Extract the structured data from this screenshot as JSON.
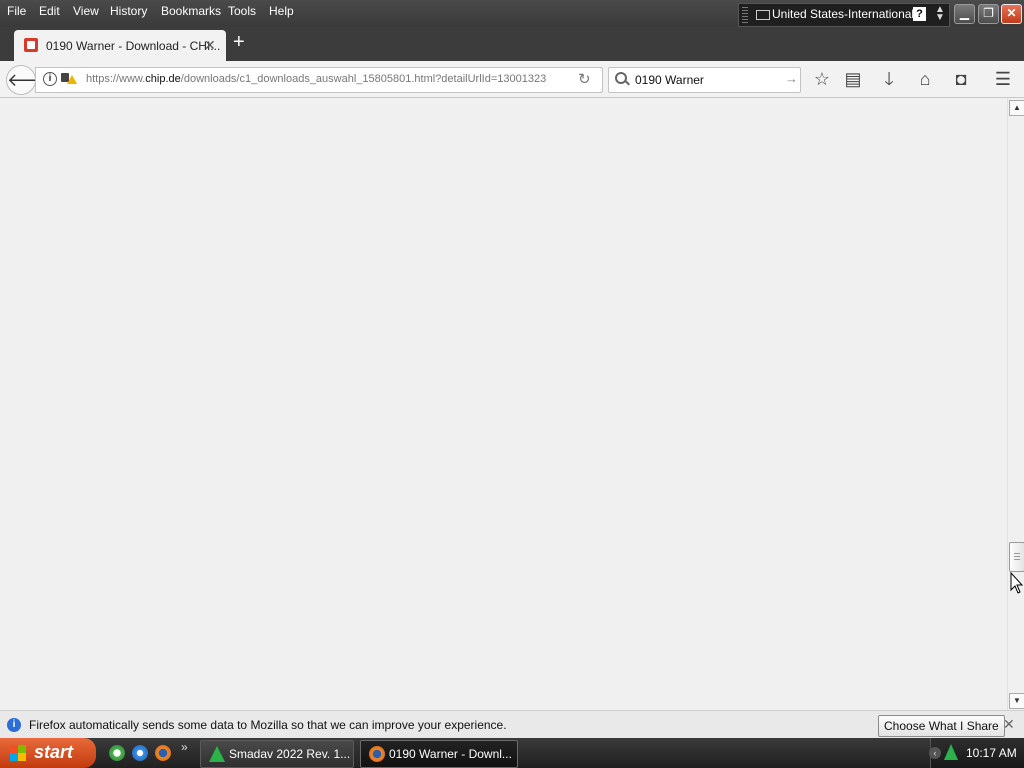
{
  "menubar": {
    "items": [
      "File",
      "Edit",
      "View",
      "History",
      "Bookmarks",
      "Tools",
      "Help"
    ]
  },
  "language_bar": {
    "language": "United States-International",
    "help": "?"
  },
  "tabs": {
    "active_title": "0190 Warner - Download - CHI...",
    "new_tab_symbol": "+"
  },
  "navbar": {
    "url_prefix": "https://www.",
    "url_host": "chip.de",
    "url_path": "/downloads/c1_downloads_auswahl_15805801.html?detailUrlId=13001323",
    "search_value": "0190 Warner"
  },
  "notification": {
    "message": "Firefox automatically sends some data to Mozilla so that we can improve your experience.",
    "share_button": "Choose What I Share"
  },
  "taskbar": {
    "start_label": "start",
    "tasks": [
      {
        "label": "Smadav 2022 Rev. 1..."
      },
      {
        "label": "0190 Warner - Downl..."
      }
    ],
    "clock": "10:17 AM"
  },
  "colors": {
    "accent_start": "#d9541f",
    "tab_favicon": "#d43b2e",
    "smadav_green": "#2bb34a"
  }
}
